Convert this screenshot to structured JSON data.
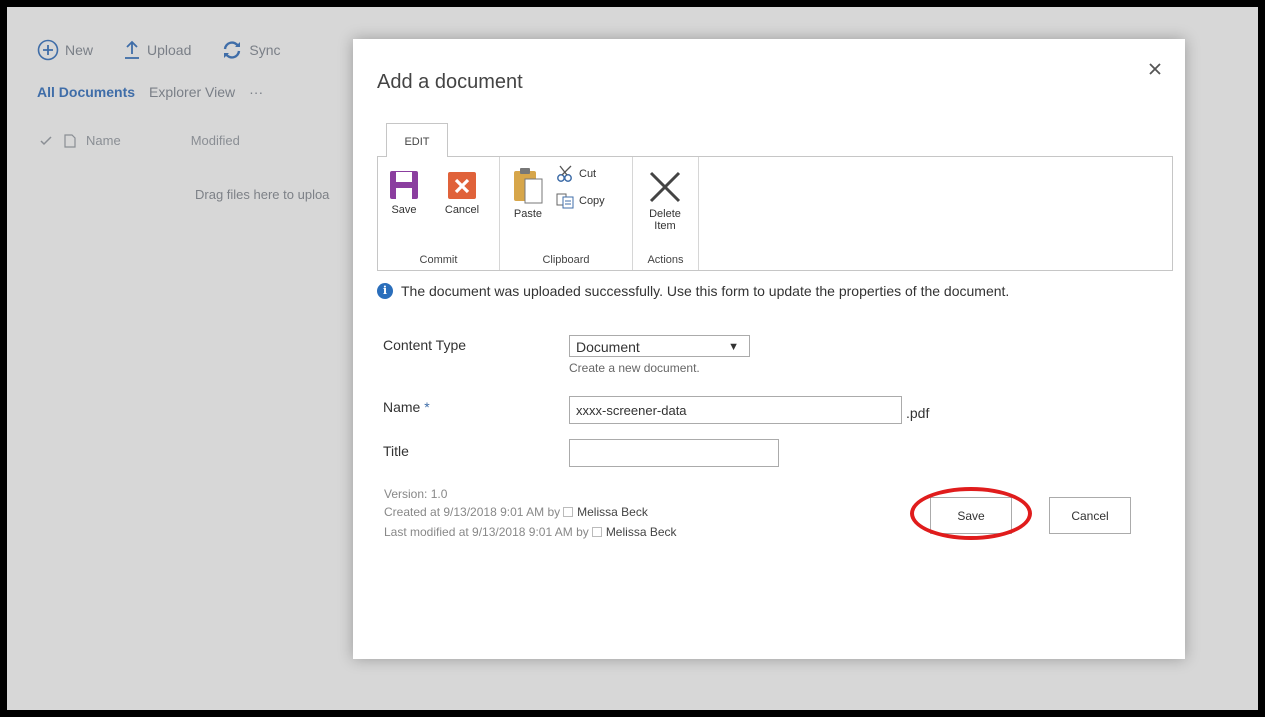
{
  "background": {
    "toolbar": {
      "new_label": "New",
      "upload_label": "Upload",
      "sync_label": "Sync"
    },
    "views": {
      "all_documents": "All Documents",
      "explorer_view": "Explorer View",
      "more": "···"
    },
    "list_header": {
      "name": "Name",
      "modified": "Modified"
    },
    "drag_text": "Drag files here to uploa"
  },
  "dialog": {
    "title": "Add a document",
    "ribbon": {
      "tab_label": "EDIT",
      "commit": {
        "save": "Save",
        "cancel": "Cancel",
        "group_label": "Commit"
      },
      "clipboard": {
        "paste": "Paste",
        "cut": "Cut",
        "copy": "Copy",
        "group_label": "Clipboard"
      },
      "actions": {
        "delete_line1": "Delete",
        "delete_line2": "Item",
        "group_label": "Actions"
      }
    },
    "info_message": "The document was uploaded successfully. Use this form to update the properties of the document.",
    "form": {
      "content_type_label": "Content Type",
      "content_type_value": "Document",
      "content_type_hint": "Create a new document.",
      "name_label": "Name",
      "name_required": "*",
      "name_value": "xxxx-screener-data",
      "name_ext": ".pdf",
      "title_label": "Title",
      "title_value": ""
    },
    "meta": {
      "version": "Version: 1.0",
      "created_prefix": "Created at 9/13/2018 9:01 AM  by",
      "created_by": "Melissa Beck",
      "modified_prefix": "Last modified at 9/13/2018 9:01 AM  by",
      "modified_by": "Melissa Beck"
    },
    "buttons": {
      "save": "Save",
      "cancel": "Cancel"
    }
  },
  "colors": {
    "highlight": "#e01c1c",
    "accent_blue": "#3f6da8",
    "save_icon_purple": "#8b3e9f",
    "cancel_icon_red": "#e0623a"
  },
  "icons": [
    "plus-circle-icon",
    "upload-icon",
    "sync-icon",
    "check-icon",
    "document-icon",
    "close-icon",
    "save-disk-icon",
    "cancel-x-icon",
    "paste-clipboard-icon",
    "cut-scissors-icon",
    "copy-icon",
    "delete-x-icon",
    "info-icon",
    "dropdown-arrow-icon"
  ]
}
